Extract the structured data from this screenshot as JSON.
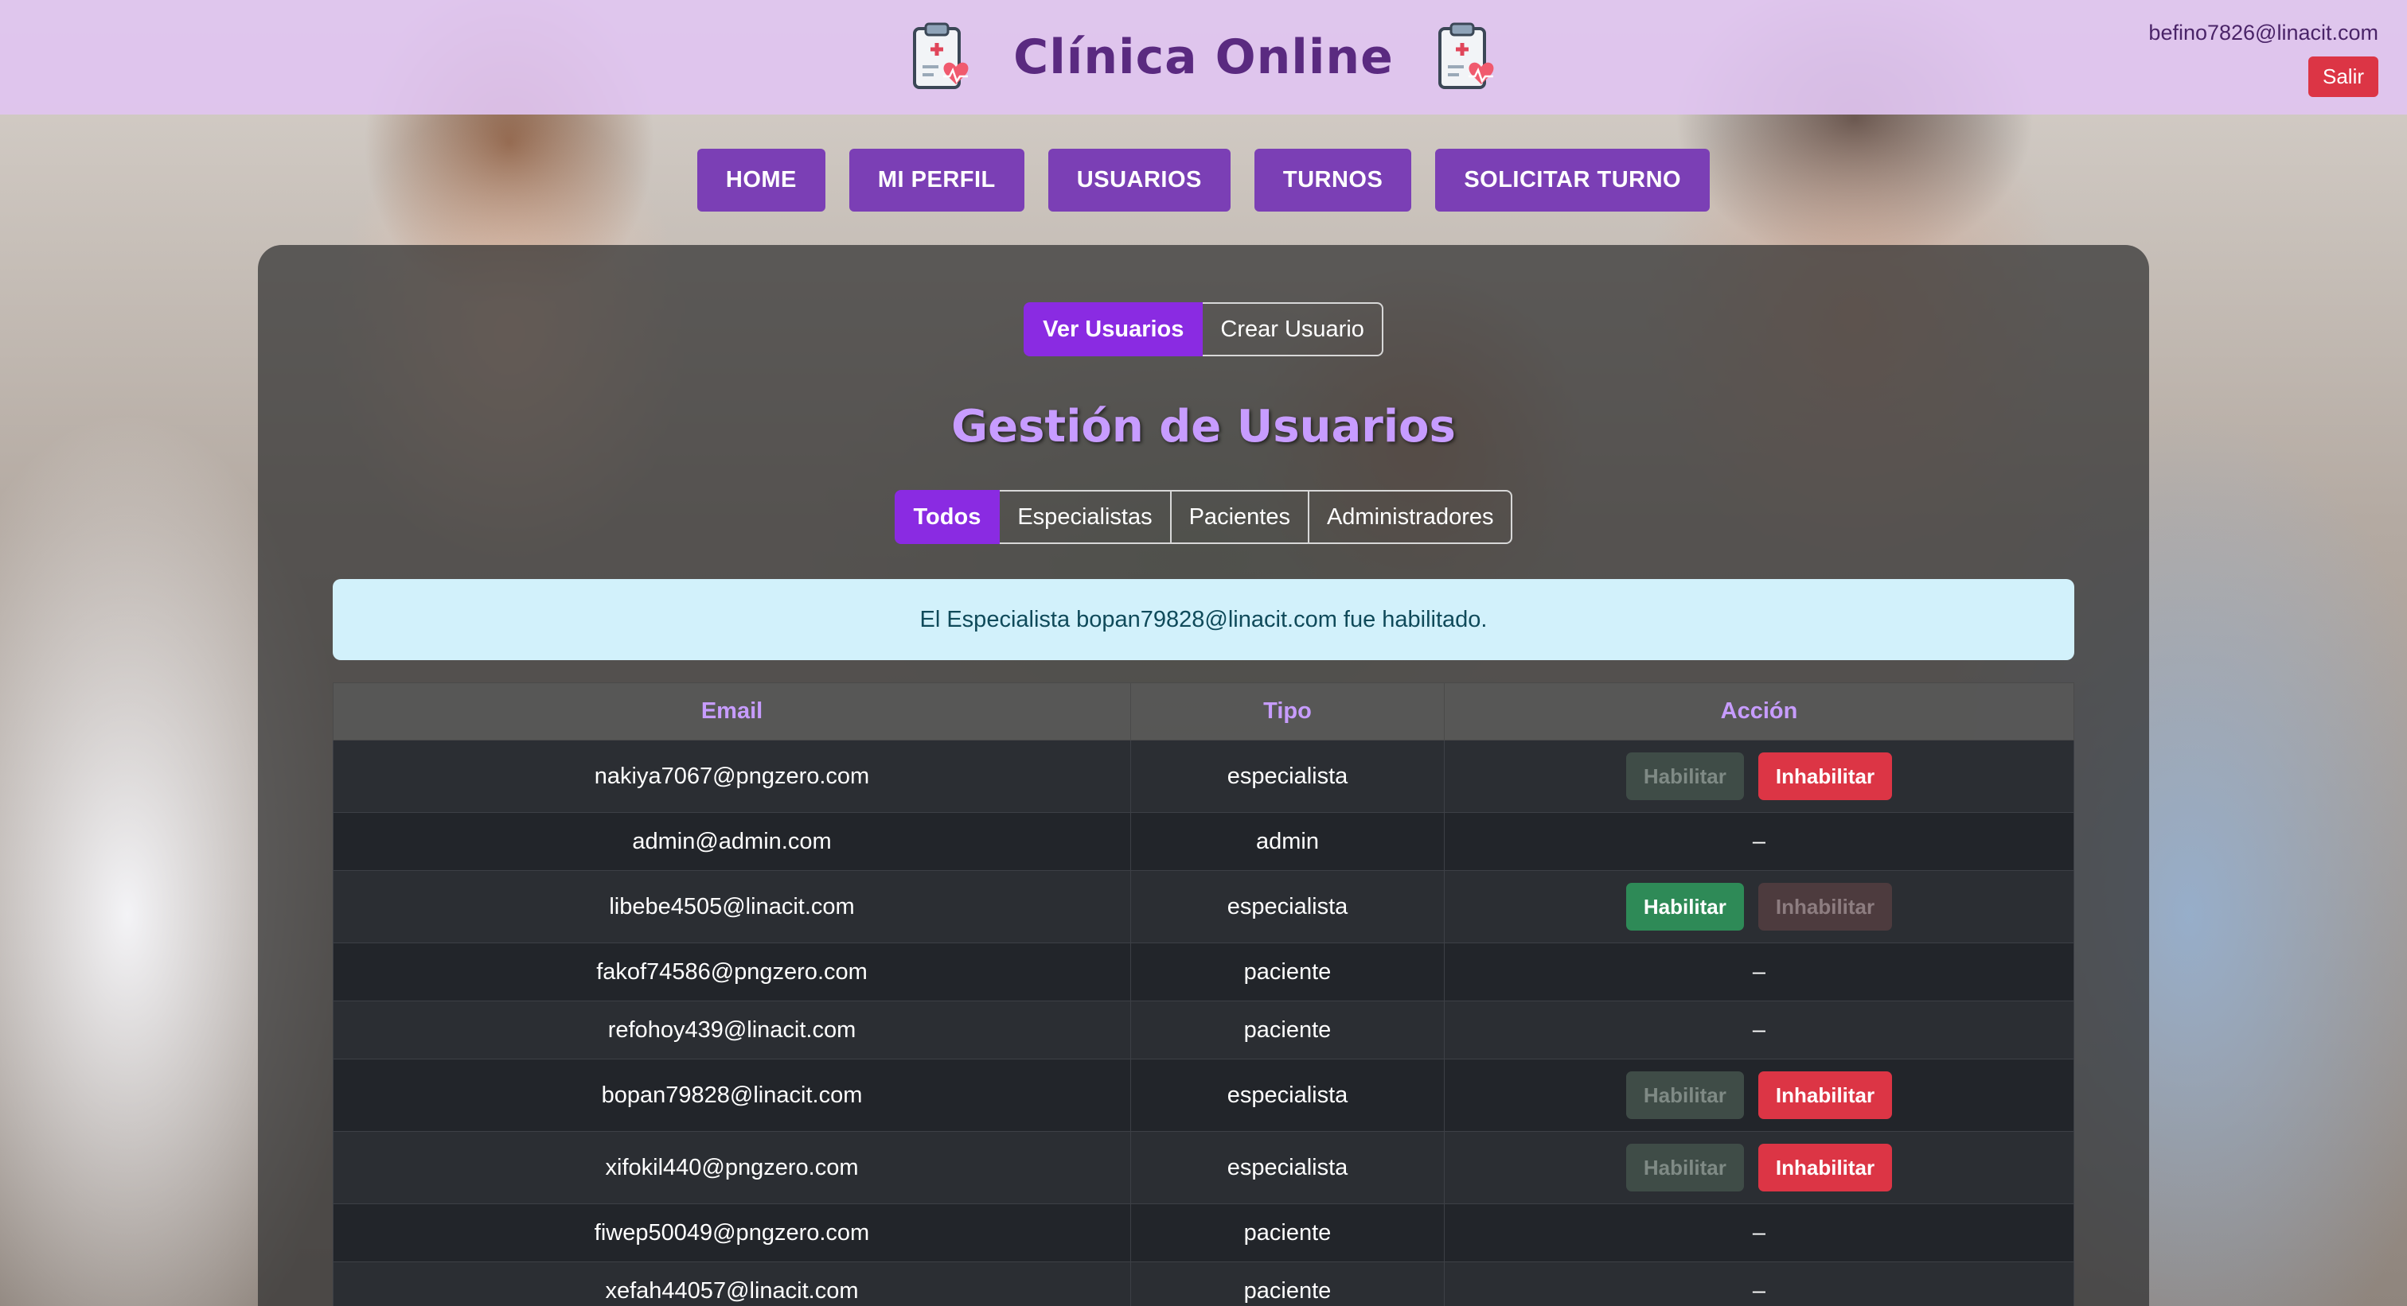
{
  "header": {
    "title": "Clínica Online",
    "user_email": "befino7826@linacit.com",
    "logout_label": "Salir"
  },
  "nav": {
    "items": [
      "HOME",
      "MI PERFIL",
      "USUARIOS",
      "TURNOS",
      "SOLICITAR TURNO"
    ]
  },
  "view_toggle": {
    "options": [
      "Ver Usuarios",
      "Crear Usuario"
    ],
    "active": "Ver Usuarios"
  },
  "page_title": "Gestión de Usuarios",
  "filters": {
    "options": [
      "Todos",
      "Especialistas",
      "Pacientes",
      "Administradores"
    ],
    "active": "Todos"
  },
  "alert": {
    "message": "El Especialista bopan79828@linacit.com fue habilitado."
  },
  "table": {
    "headers": [
      "Email",
      "Tipo",
      "Acción"
    ],
    "rows": [
      {
        "email": "nakiya7067@pngzero.com",
        "tipo": "especialista",
        "habilitado": true
      },
      {
        "email": "admin@admin.com",
        "tipo": "admin",
        "action": "–"
      },
      {
        "email": "libebe4505@linacit.com",
        "tipo": "especialista",
        "habilitado": false
      },
      {
        "email": "fakof74586@pngzero.com",
        "tipo": "paciente",
        "action": "–"
      },
      {
        "email": "refohoy439@linacit.com",
        "tipo": "paciente",
        "action": "–"
      },
      {
        "email": "bopan79828@linacit.com",
        "tipo": "especialista",
        "habilitado": true
      },
      {
        "email": "xifokil440@pngzero.com",
        "tipo": "especialista",
        "habilitado": true
      },
      {
        "email": "fiwep50049@pngzero.com",
        "tipo": "paciente",
        "action": "–"
      },
      {
        "email": "xefah44057@linacit.com",
        "tipo": "paciente",
        "action": "–"
      }
    ],
    "habilitar_label": "Habilitar",
    "inhabilitar_label": "Inhabilitar"
  },
  "colors": {
    "header_bg": "#e0c4f0",
    "nav_button": "#7b3fb5",
    "accent": "#8a2be2",
    "title": "#c79cff",
    "danger": "#dc3545",
    "success": "#2e8a57",
    "alert_bg": "#d2f1fb"
  }
}
